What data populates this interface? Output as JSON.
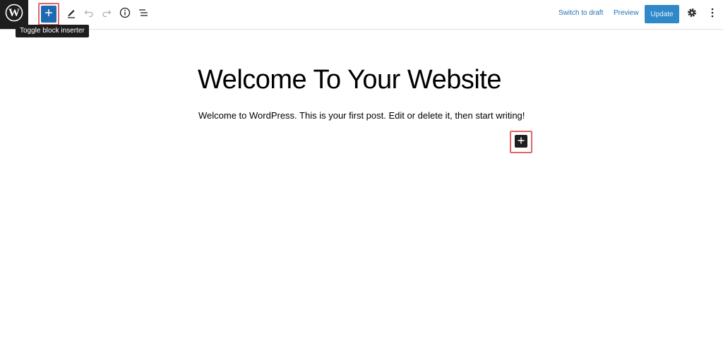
{
  "toolbar": {
    "logo_icon": "wordpress-logo-icon",
    "inserter_icon": "plus-icon",
    "tooltip": "Toggle block inserter",
    "tools": [
      {
        "icon": "pencil-icon",
        "name": "tools-button"
      },
      {
        "icon": "undo-icon",
        "name": "undo-button"
      },
      {
        "icon": "redo-icon",
        "name": "redo-button"
      },
      {
        "icon": "info-icon",
        "name": "details-button"
      },
      {
        "icon": "list-view-icon",
        "name": "list-view-button"
      }
    ],
    "switch_to_draft": "Switch to draft",
    "preview": "Preview",
    "update": "Update",
    "settings_icon": "gear-icon",
    "more_icon": "vertical-ellipsis-icon"
  },
  "editor": {
    "title": "Welcome To Your Website",
    "paragraph": "Welcome to WordPress. This is your first post. Edit or delete it, then start writing!",
    "add_block_icon": "plus-icon"
  },
  "colors": {
    "accent": "#2271b1",
    "inserter_bg": "#1e6ab0",
    "update_bg": "#2f89c9",
    "highlight": "#e06666",
    "dark": "#1e1e1e"
  }
}
